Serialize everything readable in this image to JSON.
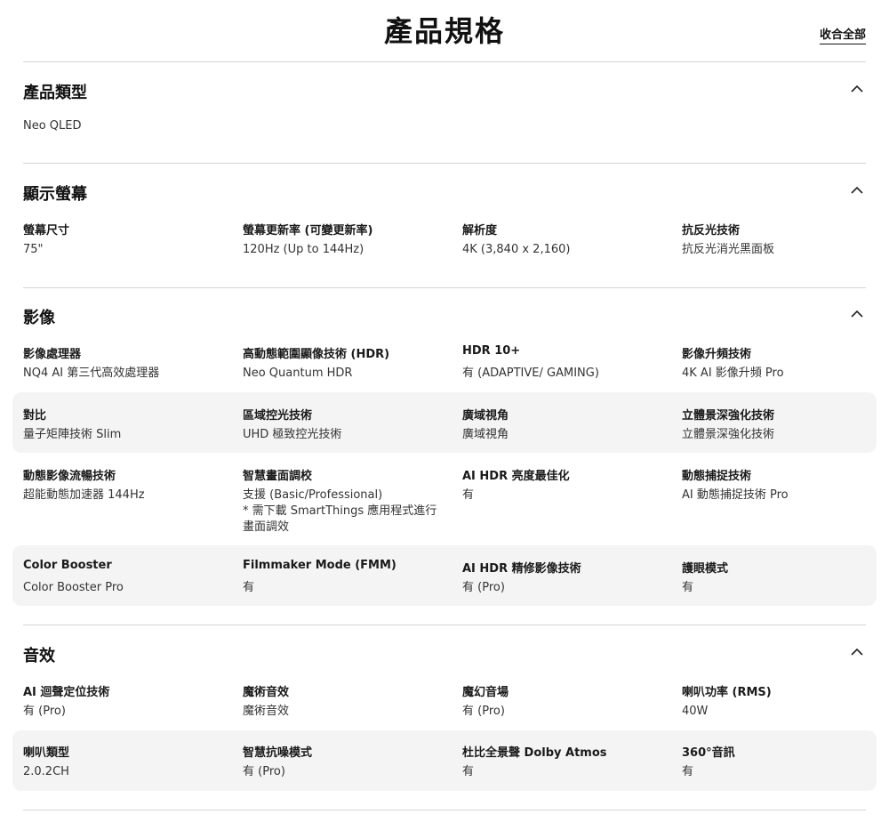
{
  "page": {
    "title": "產品規格",
    "collapse_all": "收合全部"
  },
  "sections": [
    {
      "title": "產品類型",
      "rows": [
        [
          {
            "label": "",
            "value": [
              "Neo QLED"
            ]
          }
        ]
      ]
    },
    {
      "title": "顯示螢幕",
      "rows": [
        [
          {
            "label": "螢幕尺寸",
            "value": [
              "75\""
            ]
          },
          {
            "label": "螢幕更新率 (可變更新率)",
            "value": [
              "120Hz (Up to 144Hz)"
            ]
          },
          {
            "label": "解析度",
            "value": [
              "4K (3,840 x 2,160)"
            ]
          },
          {
            "label": "抗反光技術",
            "value": [
              "抗反光消光黑面板"
            ]
          }
        ]
      ]
    },
    {
      "title": "影像",
      "rows": [
        [
          {
            "label": "影像處理器",
            "value": [
              "NQ4 AI 第三代高效處理器"
            ]
          },
          {
            "label": "高動態範圍顯像技術 (HDR)",
            "value": [
              "Neo Quantum HDR"
            ]
          },
          {
            "label": "HDR 10+",
            "value": [
              "有 (ADAPTIVE/ GAMING)"
            ]
          },
          {
            "label": "影像升頻技術",
            "value": [
              "4K AI 影像升頻 Pro"
            ]
          }
        ],
        [
          {
            "label": "對比",
            "value": [
              "量子矩陣技術 Slim"
            ]
          },
          {
            "label": "區域控光技術",
            "value": [
              "UHD 極致控光技術"
            ]
          },
          {
            "label": "廣域視角",
            "value": [
              "廣域視角"
            ]
          },
          {
            "label": "立體景深強化技術",
            "value": [
              "立體景深強化技術"
            ]
          }
        ],
        [
          {
            "label": "動態影像流暢技術",
            "value": [
              "超能動態加速器 144Hz"
            ]
          },
          {
            "label": "智慧畫面調校",
            "value": [
              "支援 (Basic/Professional)",
              "* 需下載 SmartThings 應用程式進行",
              "畫面調效"
            ]
          },
          {
            "label": "AI HDR 亮度最佳化",
            "value": [
              "有"
            ]
          },
          {
            "label": "動態捕捉技術",
            "value": [
              "AI 動態捕捉技術 Pro"
            ]
          }
        ],
        [
          {
            "label": "Color Booster",
            "value": [
              "Color Booster Pro"
            ]
          },
          {
            "label": "Filmmaker Mode (FMM)",
            "value": [
              "有"
            ]
          },
          {
            "label": "AI HDR 精修影像技術",
            "value": [
              "有 (Pro)"
            ]
          },
          {
            "label": "護眼模式",
            "value": [
              "有"
            ]
          }
        ]
      ]
    },
    {
      "title": "音效",
      "rows": [
        [
          {
            "label": "AI 迴聲定位技術",
            "value": [
              "有 (Pro)"
            ]
          },
          {
            "label": "魔術音效",
            "value": [
              "魔術音效"
            ]
          },
          {
            "label": "魔幻音場",
            "value": [
              "有 (Pro)"
            ]
          },
          {
            "label": "喇叭功率 (RMS)",
            "value": [
              "40W"
            ]
          }
        ],
        [
          {
            "label": "喇叭類型",
            "value": [
              "2.0.2CH"
            ]
          },
          {
            "label": "智慧抗噪模式",
            "value": [
              "有 (Pro)"
            ]
          },
          {
            "label": "杜比全景聲 Dolby Atmos",
            "value": [
              "有"
            ]
          },
          {
            "label": "360°音訊",
            "value": [
              "有"
            ]
          }
        ]
      ]
    }
  ],
  "icons": {
    "section_toggle": "chevron-up-icon"
  },
  "colors": {
    "text": "#1a1a1a",
    "divider": "#d5d5d5",
    "row_alt_bg": "#f4f4f4"
  }
}
